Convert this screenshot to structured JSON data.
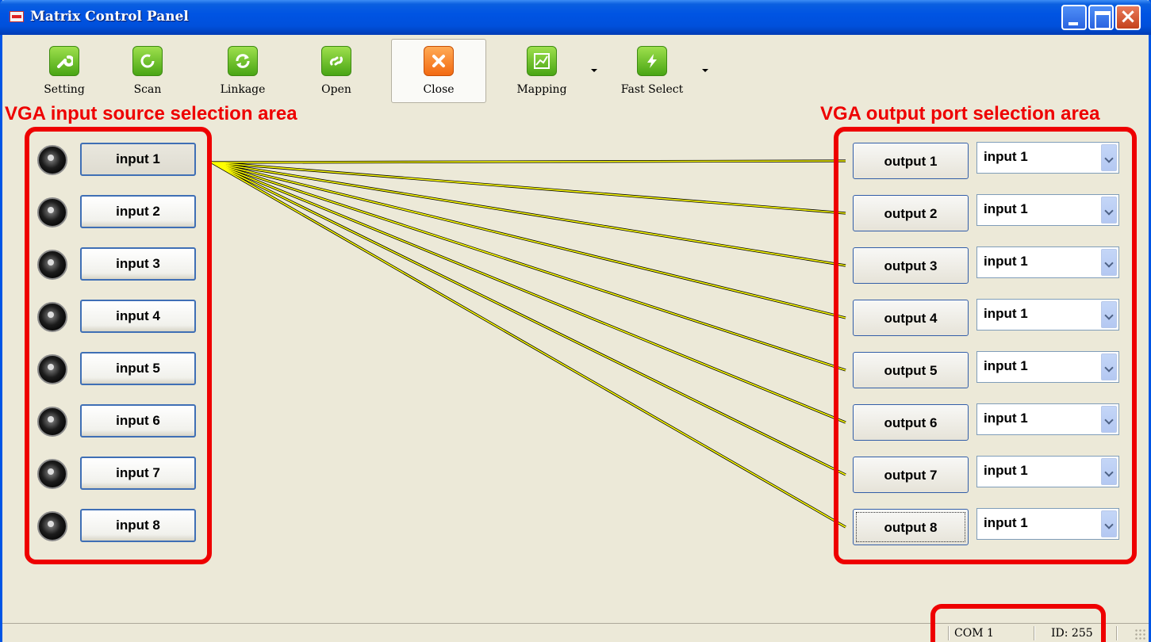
{
  "window": {
    "title": "Matrix Control Panel"
  },
  "toolbar": {
    "items": [
      {
        "label": "Setting",
        "icon": "wrench-icon"
      },
      {
        "label": "Scan",
        "icon": "refresh-circle-icon"
      },
      {
        "label": "Linkage",
        "icon": "sync-arrows-icon"
      },
      {
        "label": "Open",
        "icon": "link-icon"
      },
      {
        "label": "Close",
        "icon": "close-x-icon",
        "active": true
      },
      {
        "label": "Mapping",
        "icon": "chart-icon",
        "dropdown": true
      },
      {
        "label": "Fast Select",
        "icon": "lightning-icon",
        "dropdown": true
      }
    ]
  },
  "annotations": {
    "input_area": "VGA input source selection area",
    "output_area": "VGA output port selection area"
  },
  "inputs": [
    {
      "label": "input 1",
      "pressed": true
    },
    {
      "label": "input 2"
    },
    {
      "label": "input 3"
    },
    {
      "label": "input 4"
    },
    {
      "label": "input 5"
    },
    {
      "label": "input 6"
    },
    {
      "label": "input 7"
    },
    {
      "label": "input 8"
    }
  ],
  "outputs": [
    {
      "label": "output 1",
      "source": "input 1"
    },
    {
      "label": "output 2",
      "source": "input 1"
    },
    {
      "label": "output 3",
      "source": "input 1"
    },
    {
      "label": "output 4",
      "source": "input 1"
    },
    {
      "label": "output 5",
      "source": "input 1"
    },
    {
      "label": "output 6",
      "source": "input 1"
    },
    {
      "label": "output 7",
      "source": "input 1"
    },
    {
      "label": "output 8",
      "source": "input 1",
      "focused": true
    }
  ],
  "status": {
    "port": "COM 1",
    "id": "ID: 255"
  },
  "colors": {
    "annotation": "#ee0000",
    "link_line": "#ffff00",
    "titlebar": "#0054e3"
  }
}
